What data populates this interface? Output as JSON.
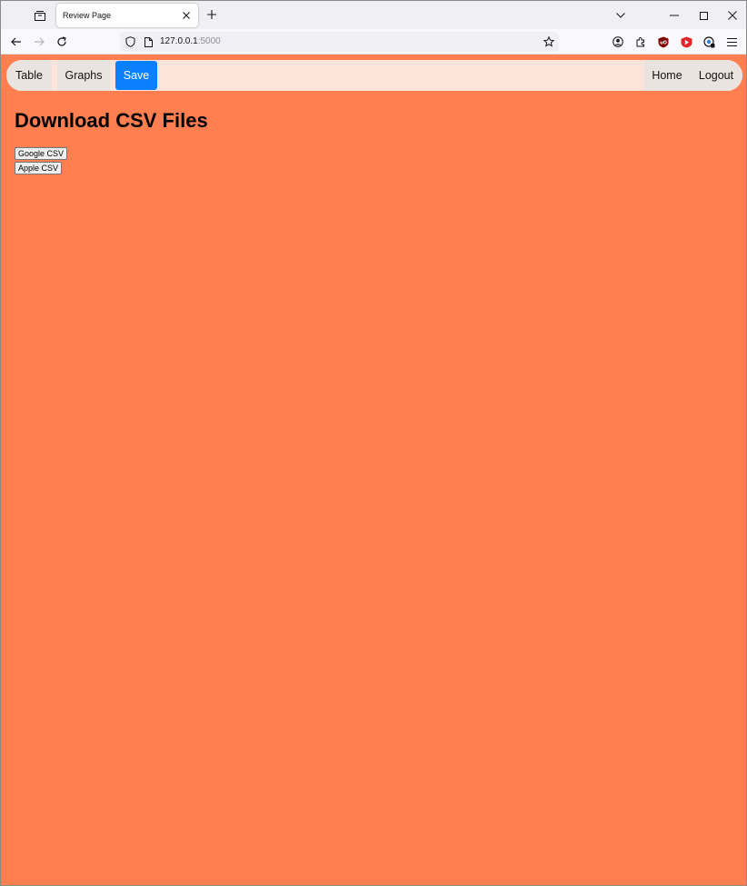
{
  "browser": {
    "tab_title": "Review Page",
    "url_host": "127.0.0.1",
    "url_port": ":5000"
  },
  "colors": {
    "page_background": "#ff7f50",
    "nav_background": "#fde4da",
    "active_button": "#0a80ff"
  },
  "site_nav": {
    "left_links": [
      "Table",
      "Graphs",
      "Save"
    ],
    "active_link": "Save",
    "right_links": [
      "Home",
      "Logout"
    ]
  },
  "main": {
    "title": "Download CSV Files",
    "buttons": [
      "Google CSV",
      "Apple CSV"
    ]
  },
  "icons": {
    "tabstrip": [
      "tab-list-icon",
      "close-icon",
      "plus-icon"
    ],
    "window": [
      "chevron-down-icon",
      "minimize-icon",
      "maximize-icon",
      "close-icon"
    ],
    "nav": [
      "back-arrow-icon",
      "forward-arrow-icon",
      "reload-icon"
    ],
    "urlbar": [
      "shield-icon",
      "page-icon",
      "star-icon"
    ],
    "toolbar": [
      "account-icon",
      "extensions-icon",
      "ublock-icon",
      "red-extension-icon",
      "extension-icon",
      "menu-icon"
    ]
  }
}
